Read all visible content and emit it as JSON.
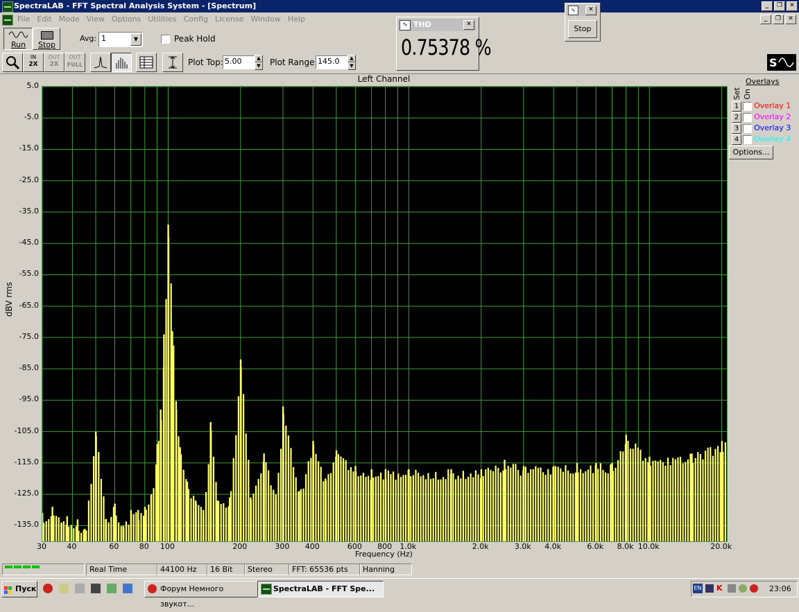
{
  "window": {
    "title": "SpectraLAB - FFT Spectral Analysis System - [Spectrum]"
  },
  "menu": [
    "File",
    "Edit",
    "Mode",
    "View",
    "Options",
    "Utilities",
    "Config",
    "License",
    "Window",
    "Help"
  ],
  "toolbar": {
    "run_label": "Run",
    "stop_label": "Stop",
    "avg_label": "Avg:",
    "avg_value": "1",
    "peak_hold_label": "Peak Hold",
    "plot_top_label": "Plot Top:",
    "plot_top_value": "5.00",
    "plot_range_label": "Plot Range:",
    "plot_range_value": "145.0",
    "zoom_in_label": "IN",
    "zoom_in_sub": "2X",
    "zoom_out_label": "OUT",
    "zoom_out_sub": "2X",
    "zoom_full_label": "OUT",
    "zoom_full_sub": "FULL"
  },
  "thd": {
    "title": "THD",
    "value": "0.75378 %"
  },
  "stop_window": {
    "button_label": "Stop"
  },
  "plot": {
    "title": "Left Channel",
    "ylabel": "dBV rms",
    "xlabel": "Frequency (Hz)",
    "grid_color": "#3aa03a",
    "bar_color": "#ffff66"
  },
  "overlays": {
    "title": "Overlays",
    "set_label": "Set",
    "on_label": "On",
    "items": [
      {
        "num": "1",
        "label": "Overlay 1",
        "color": "#ff0000"
      },
      {
        "num": "2",
        "label": "Overlay 2",
        "color": "#ff00ff"
      },
      {
        "num": "3",
        "label": "Overlay 3",
        "color": "#0000ff"
      },
      {
        "num": "4",
        "label": "Overlay 4",
        "color": "#00ffff"
      }
    ],
    "options_label": "Options..."
  },
  "status": {
    "mode": "Real Time",
    "rate": "44100 Hz",
    "bits": "16 Bit",
    "channels": "Stereo",
    "fft": "FFT: 65536 pts",
    "window": "Hanning"
  },
  "taskbar": {
    "start_label": "Пуск",
    "task1": "Форум Немного звукот...",
    "task2": "SpectraLAB - FFT Spe...",
    "lang": "EN",
    "clock": "23:06"
  },
  "chart_data": {
    "type": "bar",
    "title": "Left Channel",
    "xlabel": "Frequency (Hz)",
    "ylabel": "dBV rms",
    "xscale": "log",
    "xlim": [
      30,
      21000
    ],
    "ylim": [
      -140,
      5
    ],
    "grid": true,
    "y_ticks": [
      "5.0",
      "-5.0",
      "-15.0",
      "-25.0",
      "-35.0",
      "-45.0",
      "-55.0",
      "-65.0",
      "-75.0",
      "-85.0",
      "-95.0",
      "-105.0",
      "-115.0",
      "-125.0",
      "-135.0"
    ],
    "x_ticks": [
      {
        "v": 30,
        "label": "30"
      },
      {
        "v": 40,
        "label": "40"
      },
      {
        "v": 60,
        "label": "60"
      },
      {
        "v": 80,
        "label": "80"
      },
      {
        "v": 100,
        "label": "100"
      },
      {
        "v": 200,
        "label": "200"
      },
      {
        "v": 300,
        "label": "300"
      },
      {
        "v": 400,
        "label": "400"
      },
      {
        "v": 600,
        "label": "600"
      },
      {
        "v": 800,
        "label": "800"
      },
      {
        "v": 1000,
        "label": "1.0k"
      },
      {
        "v": 2000,
        "label": "2.0k"
      },
      {
        "v": 3000,
        "label": "3.0k"
      },
      {
        "v": 4000,
        "label": "4.0k"
      },
      {
        "v": 6000,
        "label": "6.0k"
      },
      {
        "v": 8000,
        "label": "8.0k"
      },
      {
        "v": 10000,
        "label": "10.0k"
      },
      {
        "v": 20000,
        "label": "20.0k"
      }
    ],
    "peaks": [
      {
        "x": 30,
        "y": -131
      },
      {
        "x": 33,
        "y": -129
      },
      {
        "x": 36,
        "y": -134
      },
      {
        "x": 38,
        "y": -132
      },
      {
        "x": 42,
        "y": -133
      },
      {
        "x": 45,
        "y": -136
      },
      {
        "x": 50,
        "y": -105
      },
      {
        "x": 55,
        "y": -133
      },
      {
        "x": 60,
        "y": -128
      },
      {
        "x": 65,
        "y": -135
      },
      {
        "x": 70,
        "y": -130
      },
      {
        "x": 75,
        "y": -130
      },
      {
        "x": 80,
        "y": -129
      },
      {
        "x": 85,
        "y": -125
      },
      {
        "x": 90,
        "y": -109
      },
      {
        "x": 93,
        "y": -98
      },
      {
        "x": 96,
        "y": -74
      },
      {
        "x": 100,
        "y": -39
      },
      {
        "x": 104,
        "y": -73
      },
      {
        "x": 108,
        "y": -98
      },
      {
        "x": 112,
        "y": -110
      },
      {
        "x": 120,
        "y": -121
      },
      {
        "x": 130,
        "y": -127
      },
      {
        "x": 140,
        "y": -130
      },
      {
        "x": 150,
        "y": -102
      },
      {
        "x": 160,
        "y": -127
      },
      {
        "x": 180,
        "y": -126
      },
      {
        "x": 200,
        "y": -82
      },
      {
        "x": 220,
        "y": -126
      },
      {
        "x": 250,
        "y": -112
      },
      {
        "x": 280,
        "y": -125
      },
      {
        "x": 300,
        "y": -97
      },
      {
        "x": 350,
        "y": -124
      },
      {
        "x": 400,
        "y": -108
      },
      {
        "x": 450,
        "y": -120
      },
      {
        "x": 500,
        "y": -111
      },
      {
        "x": 600,
        "y": -116
      },
      {
        "x": 700,
        "y": -117
      },
      {
        "x": 800,
        "y": -117
      },
      {
        "x": 1000,
        "y": -117
      },
      {
        "x": 1500,
        "y": -117
      },
      {
        "x": 2000,
        "y": -117
      },
      {
        "x": 2500,
        "y": -114
      },
      {
        "x": 3000,
        "y": -116
      },
      {
        "x": 4000,
        "y": -116
      },
      {
        "x": 5000,
        "y": -115
      },
      {
        "x": 6000,
        "y": -115
      },
      {
        "x": 7000,
        "y": -115
      },
      {
        "x": 8000,
        "y": -106
      },
      {
        "x": 10000,
        "y": -113
      },
      {
        "x": 15000,
        "y": -112
      },
      {
        "x": 20000,
        "y": -108
      }
    ]
  }
}
